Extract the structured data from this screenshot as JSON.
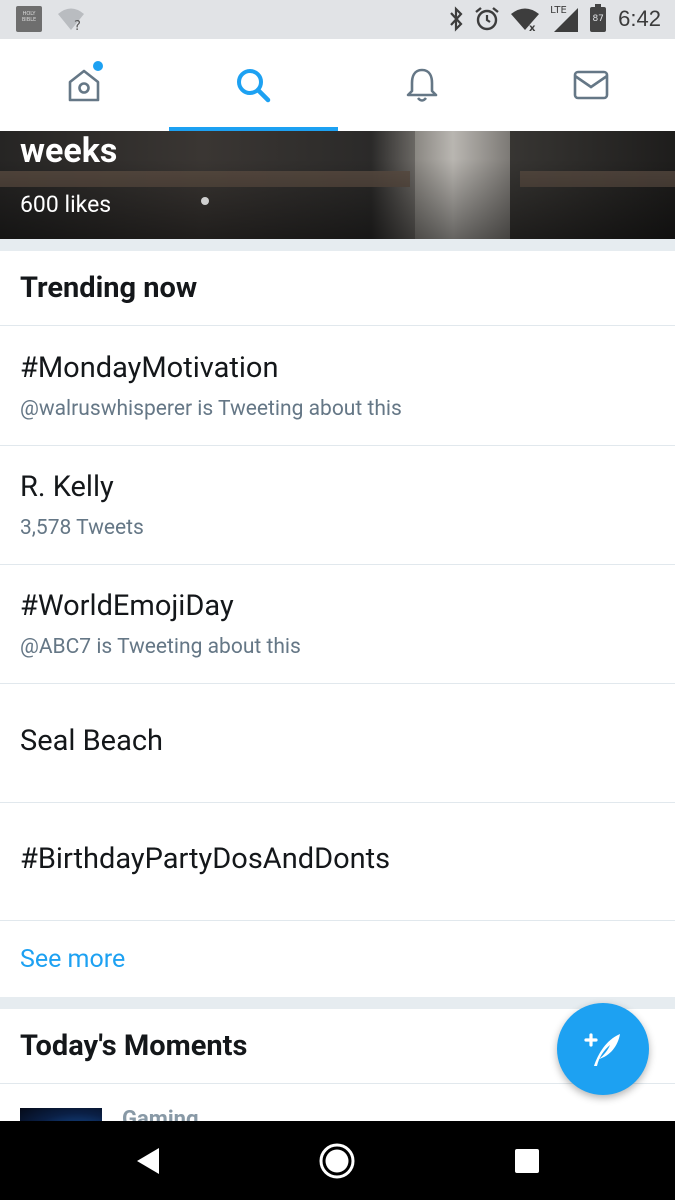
{
  "status_bar": {
    "time": "6:42",
    "battery_level": "87",
    "network": "LTE",
    "app_icon_text": "HOLY BIBLE",
    "icons": [
      "bible-app-icon",
      "wifi-unknown-icon",
      "bluetooth-icon",
      "alarm-icon",
      "wifi-icon",
      "signal-icon",
      "battery-icon"
    ]
  },
  "tabs": [
    {
      "name": "home",
      "icon": "home-icon",
      "has_notification": true
    },
    {
      "name": "search",
      "icon": "search-icon",
      "active": true
    },
    {
      "name": "notifications",
      "icon": "bell-icon"
    },
    {
      "name": "messages",
      "icon": "mail-icon"
    }
  ],
  "colors": {
    "accent": "#1da1f2",
    "secondary_text": "#657786",
    "divider": "#e1e8ed",
    "band": "#e6ecf0"
  },
  "hero": {
    "title": "weeks",
    "likes": "600 likes"
  },
  "trending": {
    "heading": "Trending now",
    "items": [
      {
        "name": "#MondayMotivation",
        "context": "@walruswhisperer is Tweeting about this"
      },
      {
        "name": "R. Kelly",
        "context": "3,578 Tweets"
      },
      {
        "name": "#WorldEmojiDay",
        "context": "@ABC7 is Tweeting about this"
      },
      {
        "name": "Seal Beach",
        "context": ""
      },
      {
        "name": "#BirthdayPartyDosAndDonts",
        "context": ""
      }
    ],
    "see_more": "See more"
  },
  "moments": {
    "heading": "Today's Moments",
    "first_category": "Gaming"
  },
  "fab": {
    "icon": "compose-tweet-icon"
  },
  "nav_bar": {
    "buttons": [
      "back-icon",
      "home-circle-icon",
      "recents-icon"
    ]
  }
}
